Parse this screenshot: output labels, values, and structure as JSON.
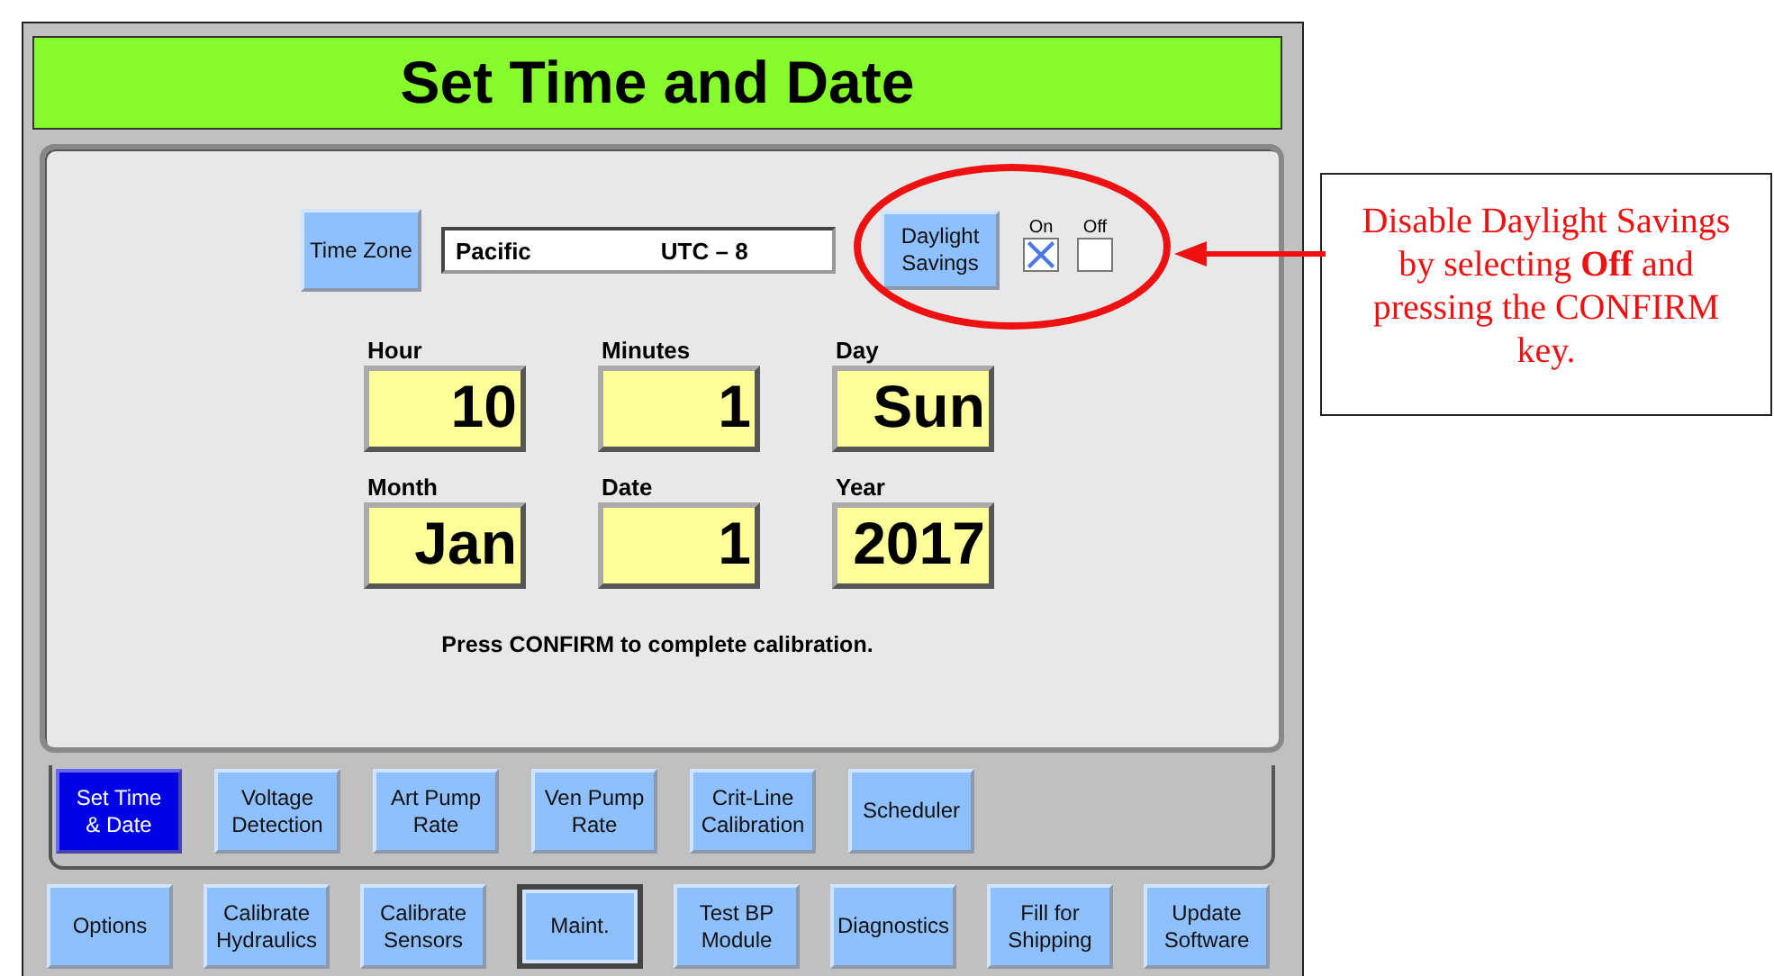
{
  "title": "Set Time and Date",
  "time_zone": {
    "button": "Time Zone",
    "zone": "Pacific",
    "offset": "UTC  – 8"
  },
  "daylight_savings": {
    "button": "Daylight\nSavings",
    "options": [
      {
        "label": "On",
        "selected": true
      },
      {
        "label": "Off",
        "selected": false
      }
    ]
  },
  "fields": [
    {
      "label": "Hour",
      "value": "10"
    },
    {
      "label": "Minutes",
      "value": "1"
    },
    {
      "label": "Day",
      "value": "Sun"
    },
    {
      "label": "Month",
      "value": "Jan"
    },
    {
      "label": "Date",
      "value": "1"
    },
    {
      "label": "Year",
      "value": "2017"
    }
  ],
  "message": "Press CONFIRM  to complete calibration.",
  "tabs": [
    {
      "label": "Set Time\n& Date",
      "selected": true
    },
    {
      "label": "Voltage\nDetection",
      "selected": false
    },
    {
      "label": "Art Pump\nRate",
      "selected": false
    },
    {
      "label": "Ven Pump\nRate",
      "selected": false
    },
    {
      "label": "Crit-Line\nCalibration",
      "selected": false
    },
    {
      "label": "Scheduler",
      "selected": false
    }
  ],
  "menu_tabs": [
    {
      "label": "Options",
      "selected": false
    },
    {
      "label": "Calibrate\nHydraulics",
      "selected": false
    },
    {
      "label": "Calibrate\nSensors",
      "selected": false
    },
    {
      "label": "Maint.",
      "selected": true
    },
    {
      "label": "Test BP\nModule",
      "selected": false
    },
    {
      "label": "Diagnostics",
      "selected": false
    },
    {
      "label": "Fill for\nShipping",
      "selected": false
    },
    {
      "label": "Update\nSoftware",
      "selected": false
    }
  ],
  "annotation": {
    "text": "Disable Daylight Savings by selecting **Off** and pressing the CONFIRM key."
  }
}
